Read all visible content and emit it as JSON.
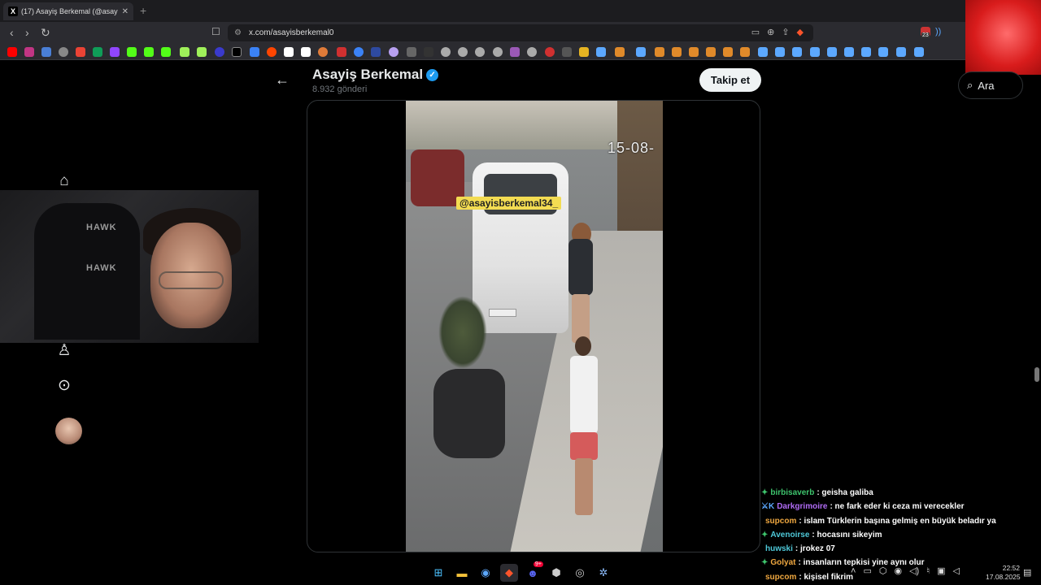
{
  "browser": {
    "tab_title": "(17) Asayiş Berkemal (@asay",
    "tab_close": "✕",
    "new_tab": "+",
    "url": "x.com/asayisberkemal0",
    "back": "‹",
    "forward": "›",
    "reload": "↻",
    "tray_badge": "23"
  },
  "profile_header": {
    "name": "Asayiş Berkemal",
    "post_count": "8.932 gönderi",
    "follow_label": "Takip et"
  },
  "search": {
    "label": "Ara"
  },
  "video": {
    "watermark": "@asayisberkemal34_",
    "timestamp": "15-08-"
  },
  "webcam": {
    "chair_brand_1": "HAWK",
    "chair_brand_2": "HAWK"
  },
  "chat": [
    {
      "badge": "✦",
      "badge_color": "#3ec46d",
      "user": "birbisaverb",
      "user_color": "#3ec46d",
      "message": ": geisha galiba"
    },
    {
      "badge": "⚔K",
      "badge_color": "#5ca8ff",
      "user": "Darkgrimoire",
      "user_color": "#b06cf5",
      "message": ": ne fark eder ki ceza mi verecekler"
    },
    {
      "badge": "",
      "badge_color": "#ffffff",
      "user": "supcom",
      "user_color": "#f0a840",
      "message": ": islam Türklerin başına gelmiş en büyük beladır ya"
    },
    {
      "badge": "✦",
      "badge_color": "#3ec46d",
      "user": "Avenoirse",
      "user_color": "#4ec8d8",
      "message": ": hocasını sikeyim"
    },
    {
      "badge": "",
      "badge_color": "#ffffff",
      "user": "huwski",
      "user_color": "#4ec8d8",
      "message": ": jrokez 07"
    },
    {
      "badge": "✦",
      "badge_color": "#3ec46d",
      "user": "Golyat",
      "user_color": "#f0a840",
      "message": ": insanların tepkisi yine aynı olur"
    },
    {
      "badge": "",
      "badge_color": "#ffffff",
      "user": "supcom",
      "user_color": "#f0a840",
      "message": ": kişisel fikrim"
    }
  ],
  "taskbar": {
    "time": "22:52",
    "date": "17.08.2025",
    "discord_badge": "9+"
  },
  "colors": {
    "accent_blue": "#1d9bf0",
    "brave_orange": "#fb542b",
    "twitter_bg": "#000000"
  }
}
